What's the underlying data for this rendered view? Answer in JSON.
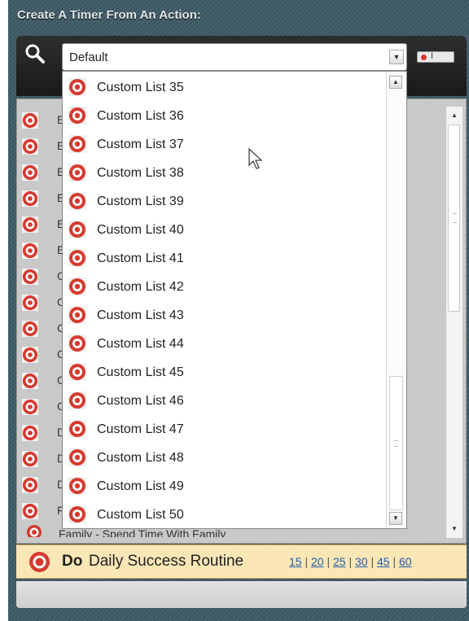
{
  "header": {
    "title": "Create A Timer From An Action:"
  },
  "search": {
    "selected_value": "Default"
  },
  "background_list": {
    "rows": [
      {
        "letter": "E"
      },
      {
        "letter": "E"
      },
      {
        "letter": "E"
      },
      {
        "letter": "E"
      },
      {
        "letter": "E"
      },
      {
        "letter": "E"
      },
      {
        "letter": "C"
      },
      {
        "letter": "C"
      },
      {
        "letter": "C"
      },
      {
        "letter": "C"
      },
      {
        "letter": "C"
      },
      {
        "letter": "C"
      },
      {
        "letter": "D"
      },
      {
        "letter": "D"
      },
      {
        "letter": "D"
      },
      {
        "letter": "F"
      }
    ],
    "partial_row": "Family - Spend Time With Family"
  },
  "dropdown": {
    "items": [
      "Custom List 35",
      "Custom List 36",
      "Custom List 37",
      "Custom List 38",
      "Custom List 39",
      "Custom List 40",
      "Custom List 41",
      "Custom List 42",
      "Custom List 43",
      "Custom List 44",
      "Custom List 45",
      "Custom List 46",
      "Custom List 47",
      "Custom List 48",
      "Custom List 49",
      "Custom List 50"
    ]
  },
  "action_bar": {
    "do_label": "Do",
    "routine_name": "Daily Success Routine",
    "durations": [
      "15",
      "20",
      "25",
      "30",
      "45",
      "60"
    ]
  },
  "colors": {
    "accent_red": "#d63a2f",
    "frame": "#3e5a66",
    "bar_bg": "#fbe6b6"
  },
  "icons": {
    "search": "magnifier-icon",
    "action": "target-icon",
    "arrow": "chevron-down-icon"
  }
}
